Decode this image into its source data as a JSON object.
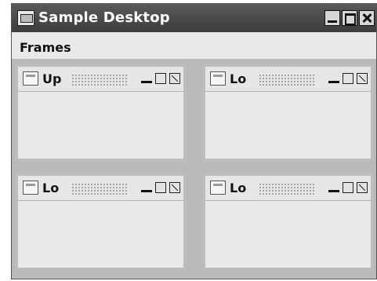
{
  "window": {
    "title": "Sample Desktop",
    "menubar": {
      "items": [
        "Frames"
      ]
    }
  },
  "internal_frames": [
    {
      "title": "Up"
    },
    {
      "title": "Lo"
    },
    {
      "title": "Lo"
    },
    {
      "title": "Lo"
    }
  ]
}
